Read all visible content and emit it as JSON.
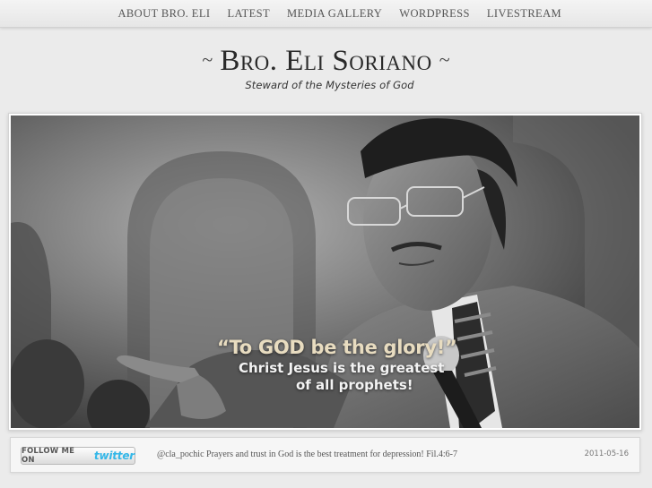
{
  "nav": {
    "items": [
      {
        "label": "ABOUT BRO. ELI"
      },
      {
        "label": "LATEST"
      },
      {
        "label": "MEDIA GALLERY"
      },
      {
        "label": "WORDPRESS"
      },
      {
        "label": "LIVESTREAM"
      }
    ]
  },
  "header": {
    "name": "Bro. Eli Soriano",
    "tagline": "Steward of the Mysteries of God",
    "swash_left": "~",
    "swash_right": "~"
  },
  "hero": {
    "quote_line1": "“To GOD be the glory!”",
    "quote_line2": "Christ Jesus is the greatest",
    "quote_line3": "of all prophets!"
  },
  "twitter": {
    "follow_prefix": "FOLLOW ME ON",
    "follow_brand": "twitter",
    "brand_color": "#33b7e8",
    "tweet_text": "@cla_pochic Prayers and trust in God is the best treatment for depression! Fil.4:6-7",
    "tweet_date": "2011-05-16"
  }
}
